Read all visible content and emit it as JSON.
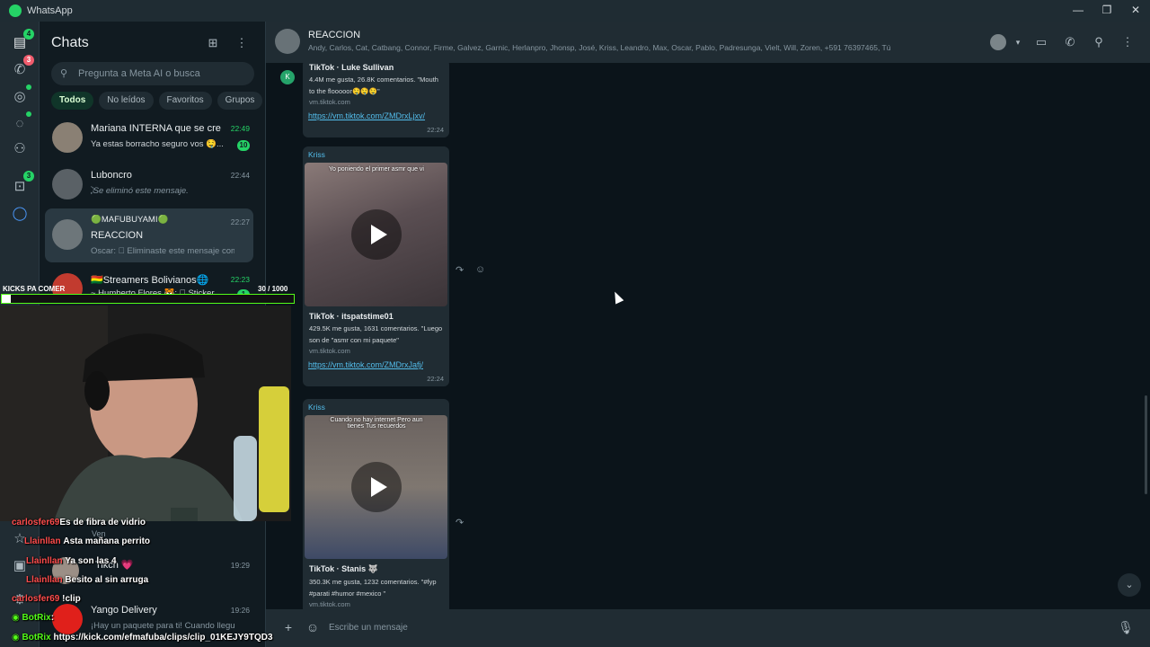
{
  "window": {
    "title": "WhatsApp",
    "minimize": "—",
    "restore": "❐",
    "close": "✕"
  },
  "rail": {
    "chats_badge": "4",
    "calls_badge": "3",
    "archive_badge": "3"
  },
  "chatlist": {
    "title": "Chats",
    "search_placeholder": "Pregunta a Meta AI o busca",
    "filters": [
      "Todos",
      "No leídos",
      "Favoritos",
      "Grupos"
    ],
    "rows": [
      {
        "name": "Mariana INTERNA que se cre...",
        "time": "22:49",
        "preview": "Ya estas borracho seguro vos 🤤...",
        "count": "10"
      },
      {
        "name": "Luboncro",
        "time": "22:44",
        "preview": "⃠ Se eliminó este mensaje."
      },
      {
        "name": "🟢MAFUBUYAMI🟢",
        "time": "22:27",
        "name2": "REACCION",
        "preview": "Oscar: ⃠ Eliminaste este mensaje com..."
      },
      {
        "name": "🇧🇴Streamers Bolivianos🌐",
        "time": "22:23",
        "preview": "~ Humberto Flores 🐯: ⃝ Sticker",
        "count": "1"
      },
      {
        "name": "Ven",
        "time": ""
      },
      {
        "name": "Tikch 💗",
        "time": "19:29"
      },
      {
        "name": "Yango Delivery",
        "time": "19:26",
        "preview": "¡Hay un paquete para ti! Cuando llegue..."
      }
    ]
  },
  "header": {
    "group_name": "REACCION",
    "members": "Andy, Carlos, Cat, Catbang, Connor, Firme, Galvez, Garnic, Herlanpro, Jhonsp, José, Kriss, Leandro, Max, Oscar, Pablo, Padresunga, Vielt, Will, Zoren, +591 76397465, Tú"
  },
  "messages": [
    {
      "kav": "K",
      "link_title": "TikTok · Luke Sullivan",
      "link_desc": "4.4M me gusta, 26.8K comentarios. \"Mouth to the flooooor🤤🤤🤤\"",
      "link_site": "vm.tiktok.com",
      "url": "https://vm.tiktok.com/ZMDrxLjxv/",
      "time": "22:24"
    },
    {
      "sender": "Kriss",
      "caption": "Yo poniendo el primer asmr que vi",
      "link_title": "TikTok · itspatstime01",
      "link_desc": "429.5K me gusta, 1631 comentarios. \"Luego son de \"asmr con mi paquete\"",
      "link_site": "vm.tiktok.com",
      "url": "https://vm.tiktok.com/ZMDrxJafj/",
      "time": "22:24"
    },
    {
      "sender": "Kriss",
      "caption": "Cuando no hay internet Pero aun tienes Tus recuerdos",
      "link_title": "TikTok · Stanis 🐺",
      "link_desc": "350.3K me gusta, 1232 comentarios. \"#fyp #parati #humor #mexico \"",
      "link_site": "vm.tiktok.com"
    }
  ],
  "composer": {
    "placeholder": "Escribe un mensaje"
  },
  "overlay": {
    "label": "KICKS PA COMER",
    "counter": "30  / 1000",
    "progress": 0.03,
    "chat": [
      {
        "user": "carlosfer69",
        "msg": "Es de fibra de vidrio",
        "color": "#ff4d4d"
      },
      {
        "user": "Llainllan",
        "msg": "Asta mañana perrito",
        "color": "#ff4d4d"
      },
      {
        "user": "Llainllan",
        "msg": "Ya son las 4",
        "color": "#ff4d4d"
      },
      {
        "user": "Llainllan",
        "msg": "Besito al sin arruga",
        "color": "#ff4d4d"
      },
      {
        "user": "carlosfer69",
        "msg": "!clip",
        "color": "#ff4d4d"
      },
      {
        "user": "BotRix",
        "msg": ":",
        "color": "#53fc18"
      },
      {
        "user": "BotRix",
        "msg": "https://kick.com/efmafuba/clips/clip_01KEJY9TQD3",
        "color": "#53fc18"
      }
    ]
  }
}
